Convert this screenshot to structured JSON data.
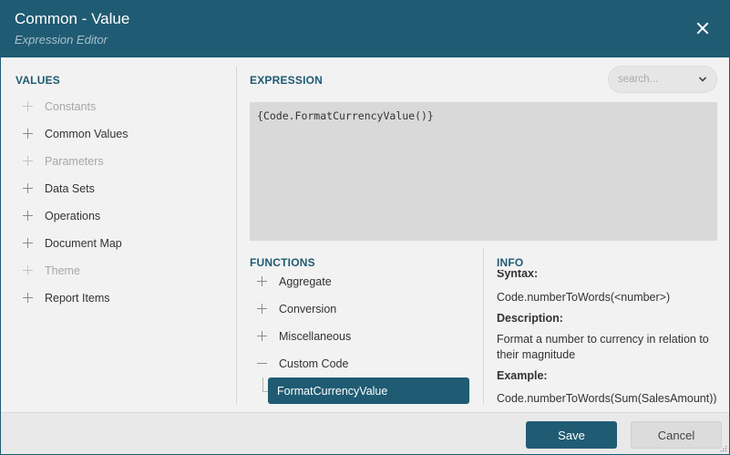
{
  "header": {
    "title": "Common - Value",
    "subtitle": "Expression Editor"
  },
  "values": {
    "title": "VALUES",
    "items": [
      {
        "label": "Constants",
        "enabled": false
      },
      {
        "label": "Common Values",
        "enabled": true
      },
      {
        "label": "Parameters",
        "enabled": false
      },
      {
        "label": "Data Sets",
        "enabled": true
      },
      {
        "label": "Operations",
        "enabled": true
      },
      {
        "label": "Document Map",
        "enabled": true
      },
      {
        "label": "Theme",
        "enabled": false
      },
      {
        "label": "Report Items",
        "enabled": true
      }
    ]
  },
  "expression": {
    "title": "EXPRESSION",
    "search_placeholder": "search...",
    "value": "{Code.FormatCurrencyValue()}"
  },
  "functions": {
    "title": "FUNCTIONS",
    "items": [
      {
        "label": "Aggregate",
        "expanded": false
      },
      {
        "label": "Conversion",
        "expanded": false
      },
      {
        "label": "Miscellaneous",
        "expanded": false
      },
      {
        "label": "Custom Code",
        "expanded": true
      }
    ],
    "selected": "FormatCurrencyValue"
  },
  "info": {
    "title": "INFO",
    "syntax_label": "Syntax:",
    "syntax": "Code.numberToWords(<number>)",
    "description_label": "Description:",
    "description_line1": "Format a number to currency in relation to",
    "description_line2": "their magnitude",
    "example_label": "Example:",
    "example": "Code.numberToWords(Sum(SalesAmount))"
  },
  "footer": {
    "save_label": "Save",
    "cancel_label": "Cancel"
  },
  "colors": {
    "accent": "#1f5b73"
  }
}
